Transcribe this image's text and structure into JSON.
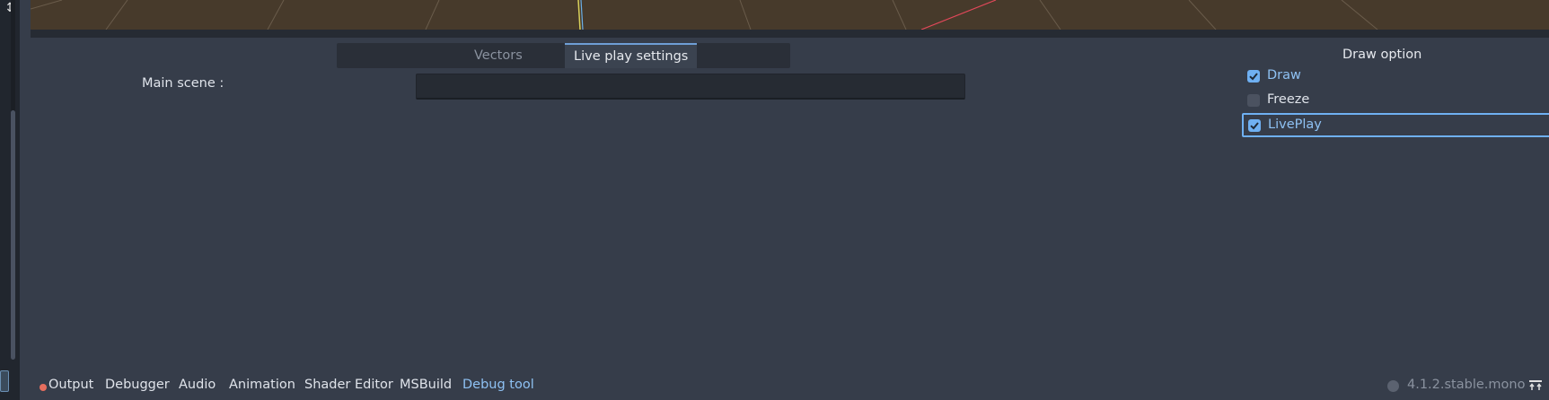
{
  "left_strip": {
    "tool_icon": "sort-arrows-icon"
  },
  "tabs": [
    {
      "label": "Vectors",
      "active": false
    },
    {
      "label": "Live play settings",
      "active": true
    }
  ],
  "main_scene": {
    "label": "Main scene :",
    "value": ""
  },
  "draw_option": {
    "title": "Draw option",
    "options": [
      {
        "label": "Draw",
        "checked": true
      },
      {
        "label": "Freeze",
        "checked": false
      },
      {
        "label": "LivePlay",
        "checked": true,
        "focused": true
      }
    ]
  },
  "bottom_panel_tabs": [
    {
      "label": "Output",
      "indicator": "error-dot"
    },
    {
      "label": "Debugger"
    },
    {
      "label": "Audio"
    },
    {
      "label": "Animation"
    },
    {
      "label": "Shader Editor"
    },
    {
      "label": "MSBuild"
    },
    {
      "label": "Debug tool",
      "active": true
    }
  ],
  "status": {
    "version": "4.1.2.stable.mono",
    "version_icon": "update-spinner-icon",
    "collapse_icon": "expand-panel-icon"
  },
  "colors": {
    "accent": "#6fb0f2",
    "viewport_bg": "#473a2b",
    "panel_bg": "#363d4a",
    "error_dot": "#e66e5e"
  }
}
